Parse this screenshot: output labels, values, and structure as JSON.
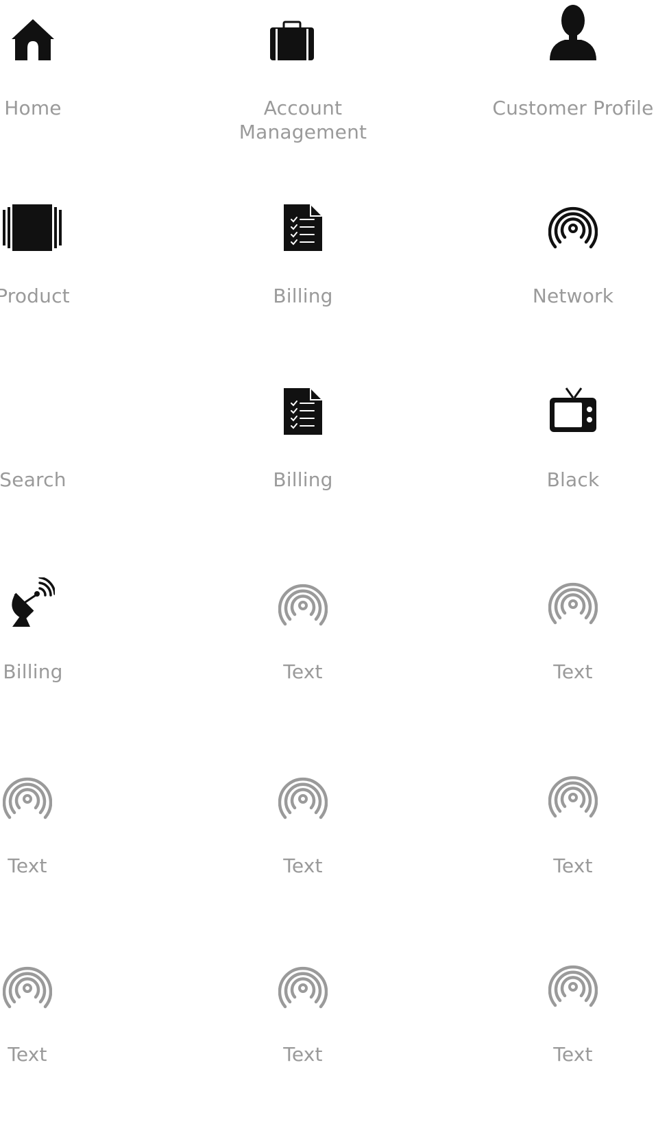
{
  "tiles": [
    {
      "label": "Home",
      "icon": "home-icon"
    },
    {
      "label": "Account Management",
      "icon": "briefcase-icon"
    },
    {
      "label": "Customer Profile",
      "icon": "user-icon"
    },
    {
      "label": "Product",
      "icon": "product-box-icon"
    },
    {
      "label": "Billing",
      "icon": "document-checklist-icon"
    },
    {
      "label": "Network",
      "icon": "signal-icon"
    },
    {
      "label": "Search",
      "icon": ""
    },
    {
      "label": "Billing",
      "icon": "document-checklist-icon"
    },
    {
      "label": "Black",
      "icon": "tv-icon"
    },
    {
      "label": "Billing",
      "icon": "satellite-dish-icon"
    },
    {
      "label": "Text",
      "icon": "signal-icon"
    },
    {
      "label": "Text",
      "icon": "signal-icon"
    },
    {
      "label": "Text",
      "icon": "signal-icon"
    },
    {
      "label": "Text",
      "icon": "signal-icon"
    },
    {
      "label": "Text",
      "icon": "signal-icon"
    },
    {
      "label": "Text",
      "icon": "signal-icon"
    },
    {
      "label": "Text",
      "icon": "signal-icon"
    },
    {
      "label": "Text",
      "icon": "signal-icon"
    }
  ],
  "colors": {
    "icon_dark": "#111111",
    "icon_grey": "#9a9a9a",
    "label": "#9a9a9a",
    "background": "#ffffff"
  }
}
